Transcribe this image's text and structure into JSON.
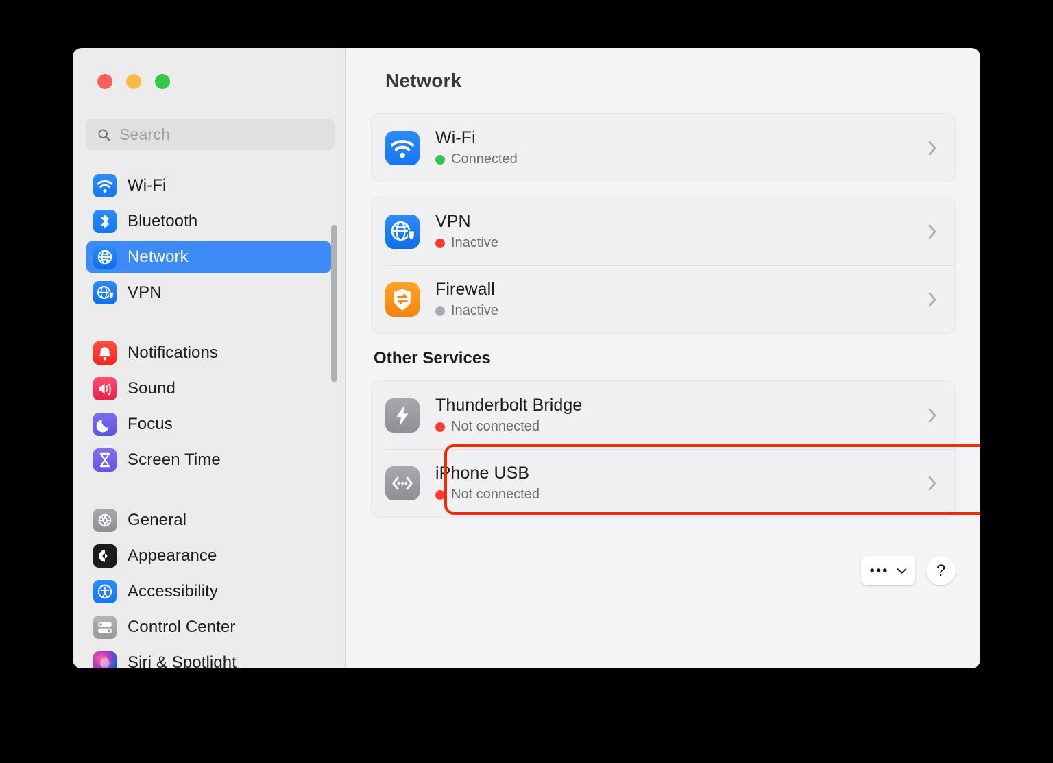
{
  "window": {
    "traffic_lights": [
      {
        "name": "close",
        "color": "#fc6058"
      },
      {
        "name": "minimize",
        "color": "#fcbb40"
      },
      {
        "name": "zoom",
        "color": "#34c749"
      }
    ]
  },
  "search": {
    "placeholder": "Search",
    "value": "",
    "icon": "search-icon"
  },
  "sidebar": {
    "groups": [
      {
        "items": [
          {
            "label": "Wi-Fi",
            "icon": "wifi-icon",
            "selected": false
          },
          {
            "label": "Bluetooth",
            "icon": "bluetooth-icon",
            "selected": false
          },
          {
            "label": "Network",
            "icon": "globe-icon",
            "selected": true
          },
          {
            "label": "VPN",
            "icon": "vpn-globe-shield-icon",
            "selected": false
          }
        ]
      },
      {
        "items": [
          {
            "label": "Notifications",
            "icon": "bell-icon",
            "selected": false
          },
          {
            "label": "Sound",
            "icon": "speaker-icon",
            "selected": false
          },
          {
            "label": "Focus",
            "icon": "moon-icon",
            "selected": false
          },
          {
            "label": "Screen Time",
            "icon": "hourglass-icon",
            "selected": false
          }
        ]
      },
      {
        "items": [
          {
            "label": "General",
            "icon": "gear-icon",
            "selected": false
          },
          {
            "label": "Appearance",
            "icon": "appearance-icon",
            "selected": false
          },
          {
            "label": "Accessibility",
            "icon": "accessibility-icon",
            "selected": false
          },
          {
            "label": "Control Center",
            "icon": "sliders-icon",
            "selected": false
          },
          {
            "label": "Siri & Spotlight",
            "icon": "siri-icon",
            "selected": false
          }
        ]
      }
    ]
  },
  "main": {
    "title": "Network",
    "cards": [
      {
        "rows": [
          {
            "name": "Wi-Fi",
            "status": "Connected",
            "status_color": "green",
            "icon": "wifi-icon"
          }
        ]
      },
      {
        "rows": [
          {
            "name": "VPN",
            "status": "Inactive",
            "status_color": "red",
            "icon": "vpn-globe-shield-icon"
          },
          {
            "name": "Firewall",
            "status": "Inactive",
            "status_color": "gray",
            "icon": "firewall-shield-icon"
          }
        ]
      }
    ],
    "section_heading": "Other Services",
    "other_services": {
      "rows": [
        {
          "name": "Thunderbolt Bridge",
          "status": "Not connected",
          "status_color": "red",
          "icon": "thunderbolt-icon",
          "highlighted": true
        },
        {
          "name": "iPhone USB",
          "status": "Not connected",
          "status_color": "red",
          "icon": "usb-brackets-icon",
          "highlighted": false
        }
      ]
    },
    "footer": {
      "more_label": "•••",
      "help_label": "?"
    }
  },
  "colors": {
    "accent_selected": "#3e8bf7",
    "annotation": "#f02d0b",
    "status_green": "#34c749",
    "status_red": "#fc3b30",
    "status_gray": "#a9a9ae"
  }
}
